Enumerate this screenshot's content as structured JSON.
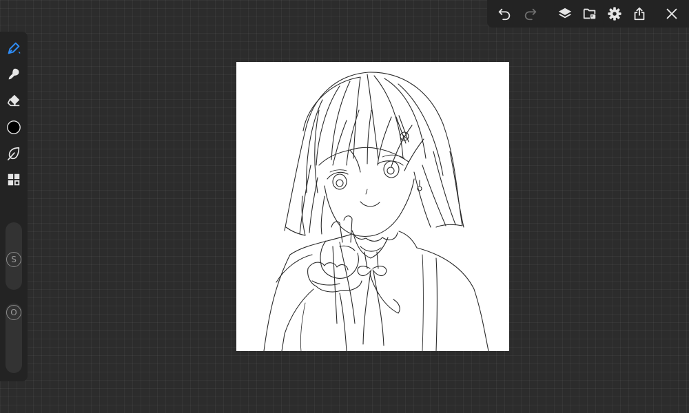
{
  "colors": {
    "workspace_bg": "#2c2c2c",
    "panel_bg": "#232323",
    "icon": "#e6e6e6",
    "icon_disabled": "#6e6e6e",
    "accent": "#2f8cf5",
    "current_color": "#000000",
    "canvas_bg": "#ffffff"
  },
  "top_toolbar": {
    "undo": {
      "icon": "undo-icon",
      "enabled": true
    },
    "redo": {
      "icon": "redo-icon",
      "enabled": false
    },
    "layers": {
      "icon": "layers-icon"
    },
    "gallery": {
      "icon": "folder-image-icon"
    },
    "settings": {
      "icon": "gear-icon"
    },
    "share": {
      "icon": "share-icon"
    },
    "close": {
      "icon": "close-icon"
    }
  },
  "left_toolbar": {
    "tools": [
      {
        "name": "brush",
        "icon": "pen-brush-icon",
        "active": true
      },
      {
        "name": "smudge",
        "icon": "smudge-icon",
        "active": false
      },
      {
        "name": "eraser",
        "icon": "eraser-icon",
        "active": false
      },
      {
        "name": "color",
        "icon": "color-swatch-icon",
        "active": false
      },
      {
        "name": "lasso",
        "icon": "lasso-leaf-icon",
        "active": false
      },
      {
        "name": "more",
        "icon": "grid-squares-icon",
        "active": false
      }
    ],
    "size_slider": {
      "label": "S"
    },
    "opacity_slider": {
      "label": "O"
    }
  },
  "canvas": {
    "content": "line-art-sketch"
  }
}
